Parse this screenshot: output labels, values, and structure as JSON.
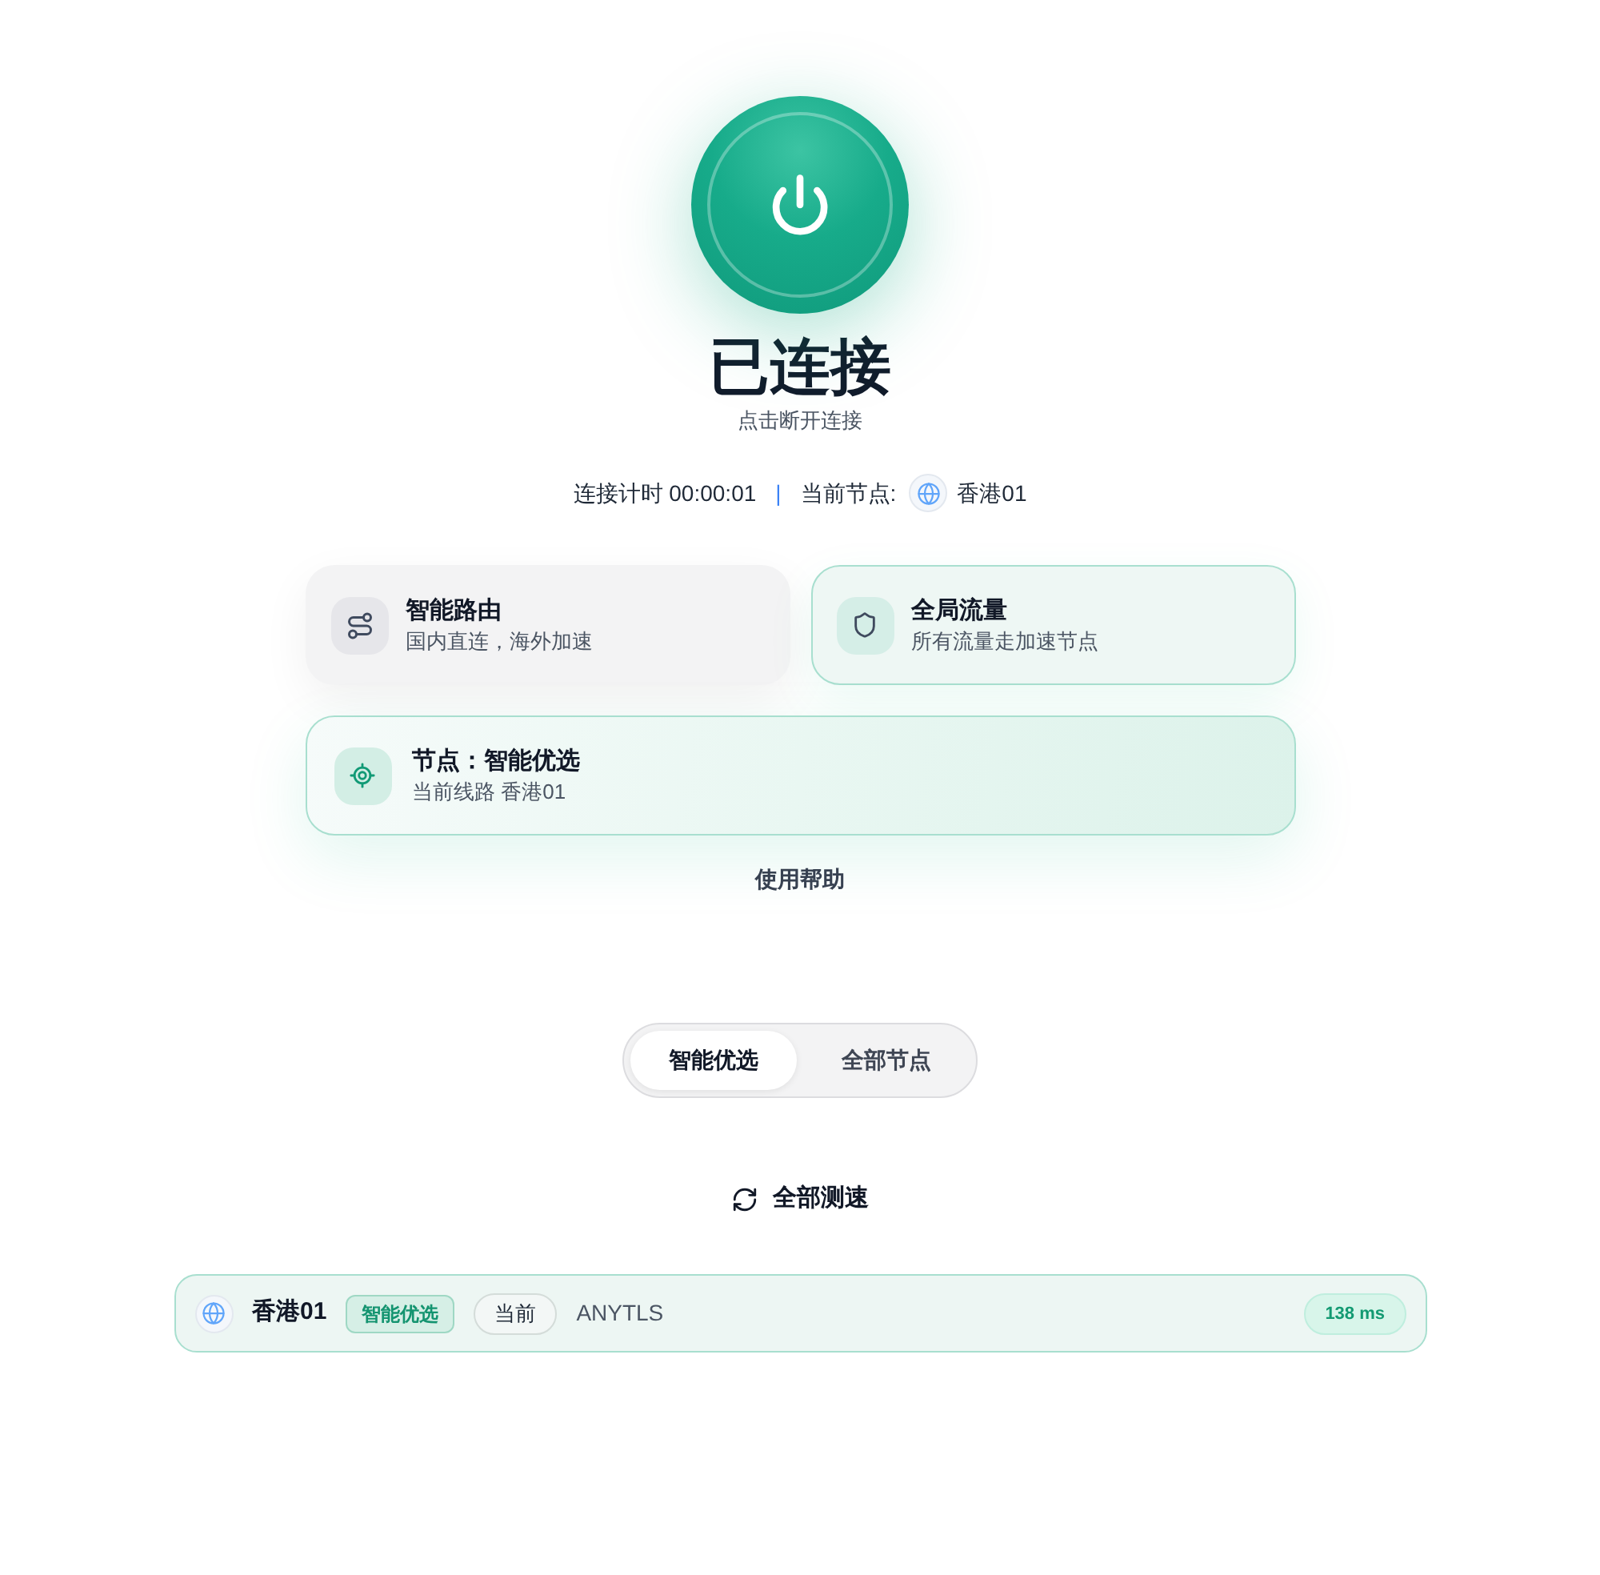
{
  "power": {
    "connected": true,
    "status": "已连接",
    "hint": "点击断开连接"
  },
  "info": {
    "timer": "连接计时 00:00:01",
    "separator": "|",
    "node_label": "当前节点:",
    "node": "香港01"
  },
  "modes": [
    {
      "kind": "route",
      "title": "智能路由",
      "subtitle": "国内直连，海外加速",
      "selected": false
    },
    {
      "kind": "global",
      "title": "全局流量",
      "subtitle": "所有流量走加速节点",
      "selected": true
    }
  ],
  "node_card": {
    "title": "节点：智能优选",
    "subtitle": "当前线路 香港01"
  },
  "help_link": "使用帮助",
  "tabs": [
    {
      "label": "智能优选",
      "selected": true
    },
    {
      "label": "全部节点",
      "selected": false
    }
  ],
  "speed_test_button": "全部测速",
  "nodes": [
    {
      "name": "香港01",
      "badge": "智能优选",
      "current_label": "当前",
      "protocol": "ANYTLS",
      "latency": "138 ms",
      "selected": true
    }
  ]
}
